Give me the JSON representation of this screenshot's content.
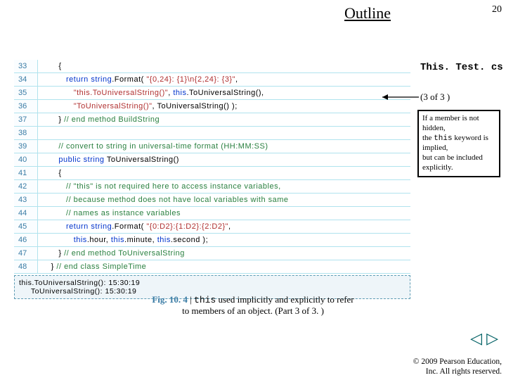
{
  "header": {
    "outline": "Outline",
    "page": "20"
  },
  "side": {
    "title": "This. Test. cs",
    "sub": "(3 of 3 )",
    "callout_line1": "If a member is not hidden,",
    "callout_line2": "the ",
    "callout_kw": "this",
    "callout_line2b": " keyword is implied,",
    "callout_line3": "but can be included",
    "callout_line4": "explicitly."
  },
  "code": [
    {
      "n": "33",
      "segs": [
        {
          "t": "      {",
          "c": ""
        }
      ]
    },
    {
      "n": "34",
      "segs": [
        {
          "t": "         ",
          "c": ""
        },
        {
          "t": "return",
          "c": "kw"
        },
        {
          "t": " ",
          "c": ""
        },
        {
          "t": "string",
          "c": "kw"
        },
        {
          "t": ".Format( ",
          "c": ""
        },
        {
          "t": "\"{0,24}: {1}\\n{2,24}: {3}\"",
          "c": "str"
        },
        {
          "t": ",",
          "c": ""
        }
      ]
    },
    {
      "n": "35",
      "segs": [
        {
          "t": "            ",
          "c": ""
        },
        {
          "t": "\"this.ToUniversalString()\"",
          "c": "str"
        },
        {
          "t": ", ",
          "c": ""
        },
        {
          "t": "this",
          "c": "kw"
        },
        {
          "t": ".ToUniversalString(),",
          "c": ""
        }
      ]
    },
    {
      "n": "36",
      "segs": [
        {
          "t": "            ",
          "c": ""
        },
        {
          "t": "\"ToUniversalString()\"",
          "c": "str"
        },
        {
          "t": ", ToUniversalString() );",
          "c": ""
        }
      ]
    },
    {
      "n": "37",
      "segs": [
        {
          "t": "      } ",
          "c": ""
        },
        {
          "t": "// end method BuildString",
          "c": "cmt"
        }
      ]
    },
    {
      "n": "38",
      "segs": [
        {
          "t": " ",
          "c": ""
        }
      ]
    },
    {
      "n": "39",
      "segs": [
        {
          "t": "      ",
          "c": ""
        },
        {
          "t": "// convert to string in universal-time format (HH:MM:SS)",
          "c": "cmt"
        }
      ]
    },
    {
      "n": "40",
      "segs": [
        {
          "t": "      ",
          "c": ""
        },
        {
          "t": "public",
          "c": "kw"
        },
        {
          "t": " ",
          "c": ""
        },
        {
          "t": "string",
          "c": "kw"
        },
        {
          "t": " ToUniversalString()",
          "c": ""
        }
      ]
    },
    {
      "n": "41",
      "segs": [
        {
          "t": "      {",
          "c": ""
        }
      ]
    },
    {
      "n": "42",
      "segs": [
        {
          "t": "         ",
          "c": ""
        },
        {
          "t": "// \"this\" is not required here to access instance variables,",
          "c": "cmt"
        }
      ]
    },
    {
      "n": "43",
      "segs": [
        {
          "t": "         ",
          "c": ""
        },
        {
          "t": "// because method does not have local variables with same",
          "c": "cmt"
        }
      ]
    },
    {
      "n": "44",
      "segs": [
        {
          "t": "         ",
          "c": ""
        },
        {
          "t": "// names as instance variables",
          "c": "cmt"
        }
      ]
    },
    {
      "n": "45",
      "segs": [
        {
          "t": "         ",
          "c": ""
        },
        {
          "t": "return",
          "c": "kw"
        },
        {
          "t": " ",
          "c": ""
        },
        {
          "t": "string",
          "c": "kw"
        },
        {
          "t": ".Format( ",
          "c": ""
        },
        {
          "t": "\"{0:D2}:{1:D2}:{2:D2}\"",
          "c": "str"
        },
        {
          "t": ",",
          "c": ""
        }
      ]
    },
    {
      "n": "46",
      "segs": [
        {
          "t": "            ",
          "c": ""
        },
        {
          "t": "this",
          "c": "kw"
        },
        {
          "t": ".hour, ",
          "c": ""
        },
        {
          "t": "this",
          "c": "kw"
        },
        {
          "t": ".minute, ",
          "c": ""
        },
        {
          "t": "this",
          "c": "kw"
        },
        {
          "t": ".second );",
          "c": ""
        }
      ]
    },
    {
      "n": "47",
      "segs": [
        {
          "t": "      } ",
          "c": ""
        },
        {
          "t": "// end method ToUniversalString",
          "c": "cmt"
        }
      ]
    },
    {
      "n": "48",
      "segs": [
        {
          "t": "   } ",
          "c": ""
        },
        {
          "t": "// end class SimpleTime",
          "c": "cmt"
        }
      ]
    }
  ],
  "output": "this.ToUniversalString(): 15:30:19\n     ToUniversalString(): 15:30:19",
  "caption": {
    "fig": "Fig. 10. 4",
    "bar": " | ",
    "kw": "this",
    "rest1": " used implicitly and explicitly to refer",
    "rest2": "to members of an object. (Part 3 of 3. )"
  },
  "nav": {
    "prev": "◁",
    "next": "▷"
  },
  "copyright": {
    "l1": "© 2009 Pearson Education,",
    "l2": "Inc. All rights reserved."
  }
}
